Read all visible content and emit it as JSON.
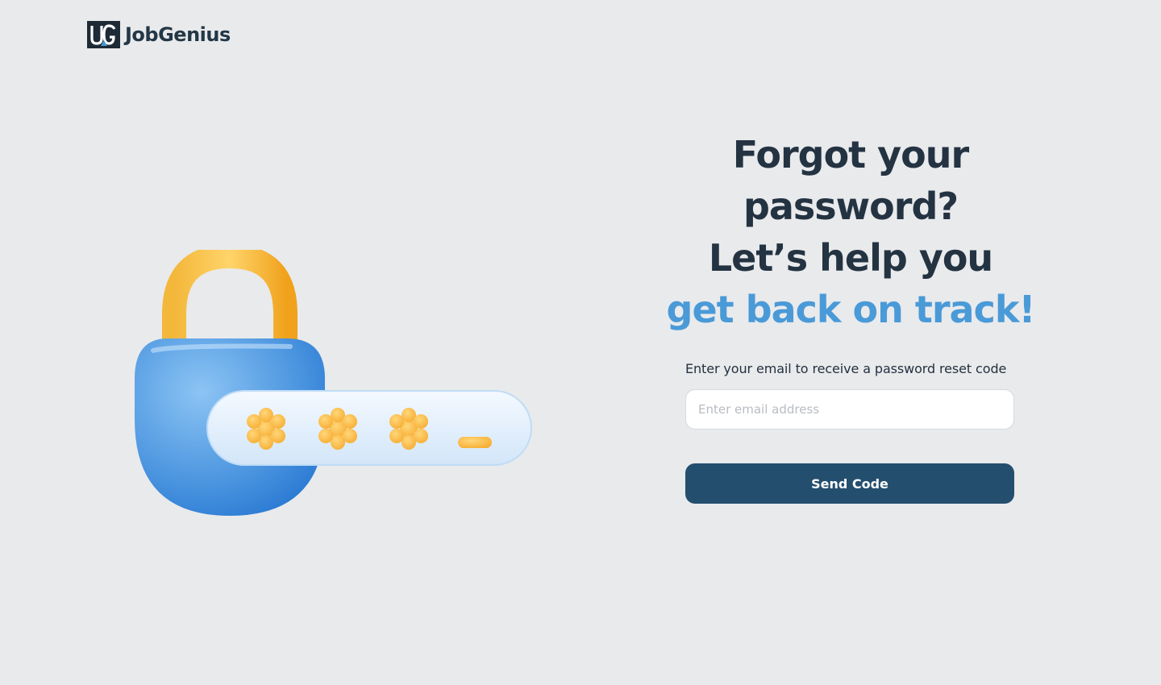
{
  "brand": {
    "logo_mark": "JG",
    "name": "JobGenius"
  },
  "headline": {
    "line1": "Forgot your password?",
    "line2": "Let’s help you",
    "line3": "get back on track!"
  },
  "form": {
    "label": "Enter your email to receive a password reset code",
    "email_placeholder": "Enter email address",
    "email_value": "",
    "submit_label": "Send Code"
  },
  "colors": {
    "background": "#e9eaec",
    "heading": "#243342",
    "accent": "#4a9ad8",
    "button": "#244e6e"
  },
  "icons": {
    "illustration": "padlock-password-icon"
  }
}
